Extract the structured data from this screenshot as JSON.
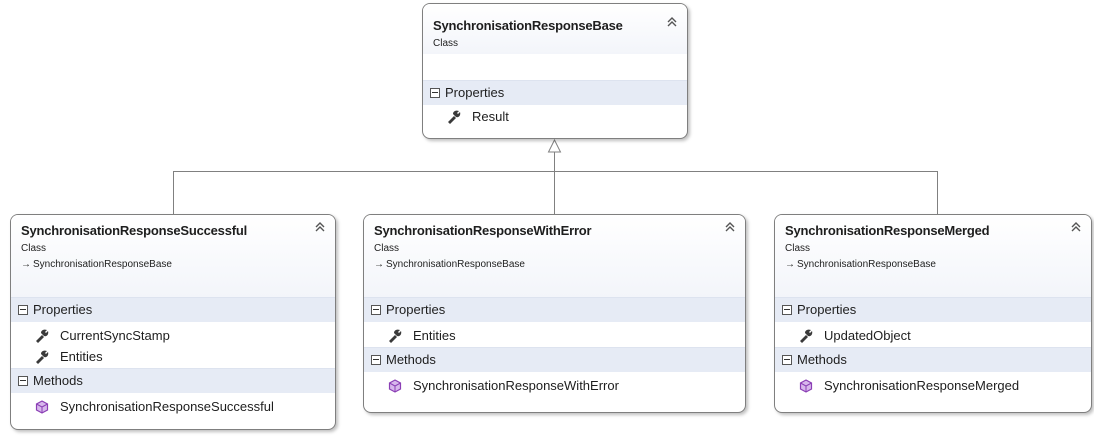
{
  "colors": {
    "section_bg": "#e6ebf5",
    "border": "#7f7f7f",
    "line": "#808080",
    "method_icon": "#8b3fb5"
  },
  "classes": {
    "base": {
      "name": "SynchronisationResponseBase",
      "kind": "Class",
      "properties_label": "Properties",
      "properties": [
        "Result"
      ]
    },
    "successful": {
      "name": "SynchronisationResponseSuccessful",
      "kind": "Class",
      "inherits": "SynchronisationResponseBase",
      "properties_label": "Properties",
      "properties": [
        "CurrentSyncStamp",
        "Entities"
      ],
      "methods_label": "Methods",
      "methods": [
        "SynchronisationResponseSuccessful"
      ]
    },
    "with_error": {
      "name": "SynchronisationResponseWithError",
      "kind": "Class",
      "inherits": "SynchronisationResponseBase",
      "properties_label": "Properties",
      "properties": [
        "Entities"
      ],
      "methods_label": "Methods",
      "methods": [
        "SynchronisationResponseWithError"
      ]
    },
    "merged": {
      "name": "SynchronisationResponseMerged",
      "kind": "Class",
      "inherits": "SynchronisationResponseBase",
      "properties_label": "Properties",
      "properties": [
        "UpdatedObject"
      ],
      "methods_label": "Methods",
      "methods": [
        "SynchronisationResponseMerged"
      ]
    }
  },
  "icons": {
    "property": "wrench-icon",
    "method": "method-cube-icon",
    "collapse": "double-chevron-up-icon",
    "toggle": "collapse-minus-icon"
  }
}
